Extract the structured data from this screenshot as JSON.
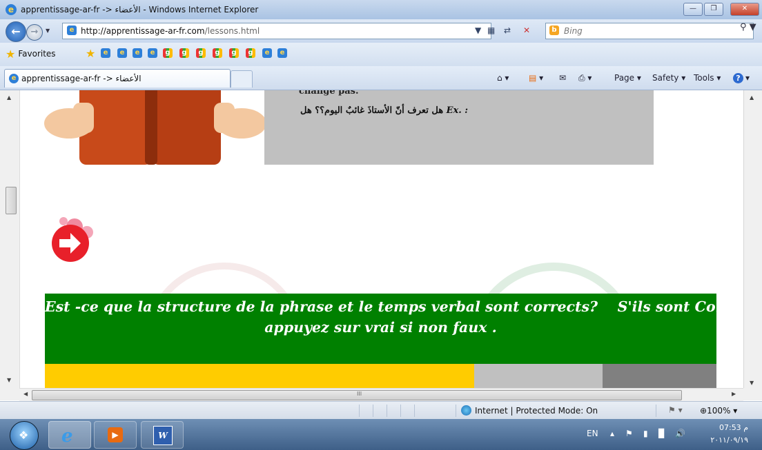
{
  "window": {
    "title": "apprentissage-ar-fr -> الأعضاء - Windows Internet Explorer"
  },
  "address": {
    "url_host": "http://apprentissage-ar-fr.com",
    "url_path": "/lessons.html",
    "search_placeholder": "Bing"
  },
  "favorites": {
    "label": "Favorites"
  },
  "tabs": {
    "active_label": "apprentissage-ar-fr -> الأعضاء"
  },
  "commands": {
    "page": "Page",
    "safety": "Safety",
    "tools": "Tools",
    "help": "?"
  },
  "content": {
    "gray_top_text": "change pas.",
    "example_prefix": "Ex. :",
    "example_arabic": "هل تعرف أنّ الأستاذَ غائبٌ اليوم؟؟ هل",
    "banner_line1": "Est -ce que la structure de la phrase et le temps verbal sont corrects?    S'ils sont Corrects ,",
    "banner_line2": "appuyez sur vrai si non faux ."
  },
  "statusbar": {
    "zone": "Internet | Protected Mode: On",
    "zoom": "100%"
  },
  "taskbar": {
    "lang": "EN",
    "time": "07:53 م",
    "date": "٢٠١١/٠٩/١٩"
  },
  "colors": {
    "banner": "#008000",
    "yellow_bar": "#ffcc00",
    "gray_panel": "#c0c0c0"
  }
}
